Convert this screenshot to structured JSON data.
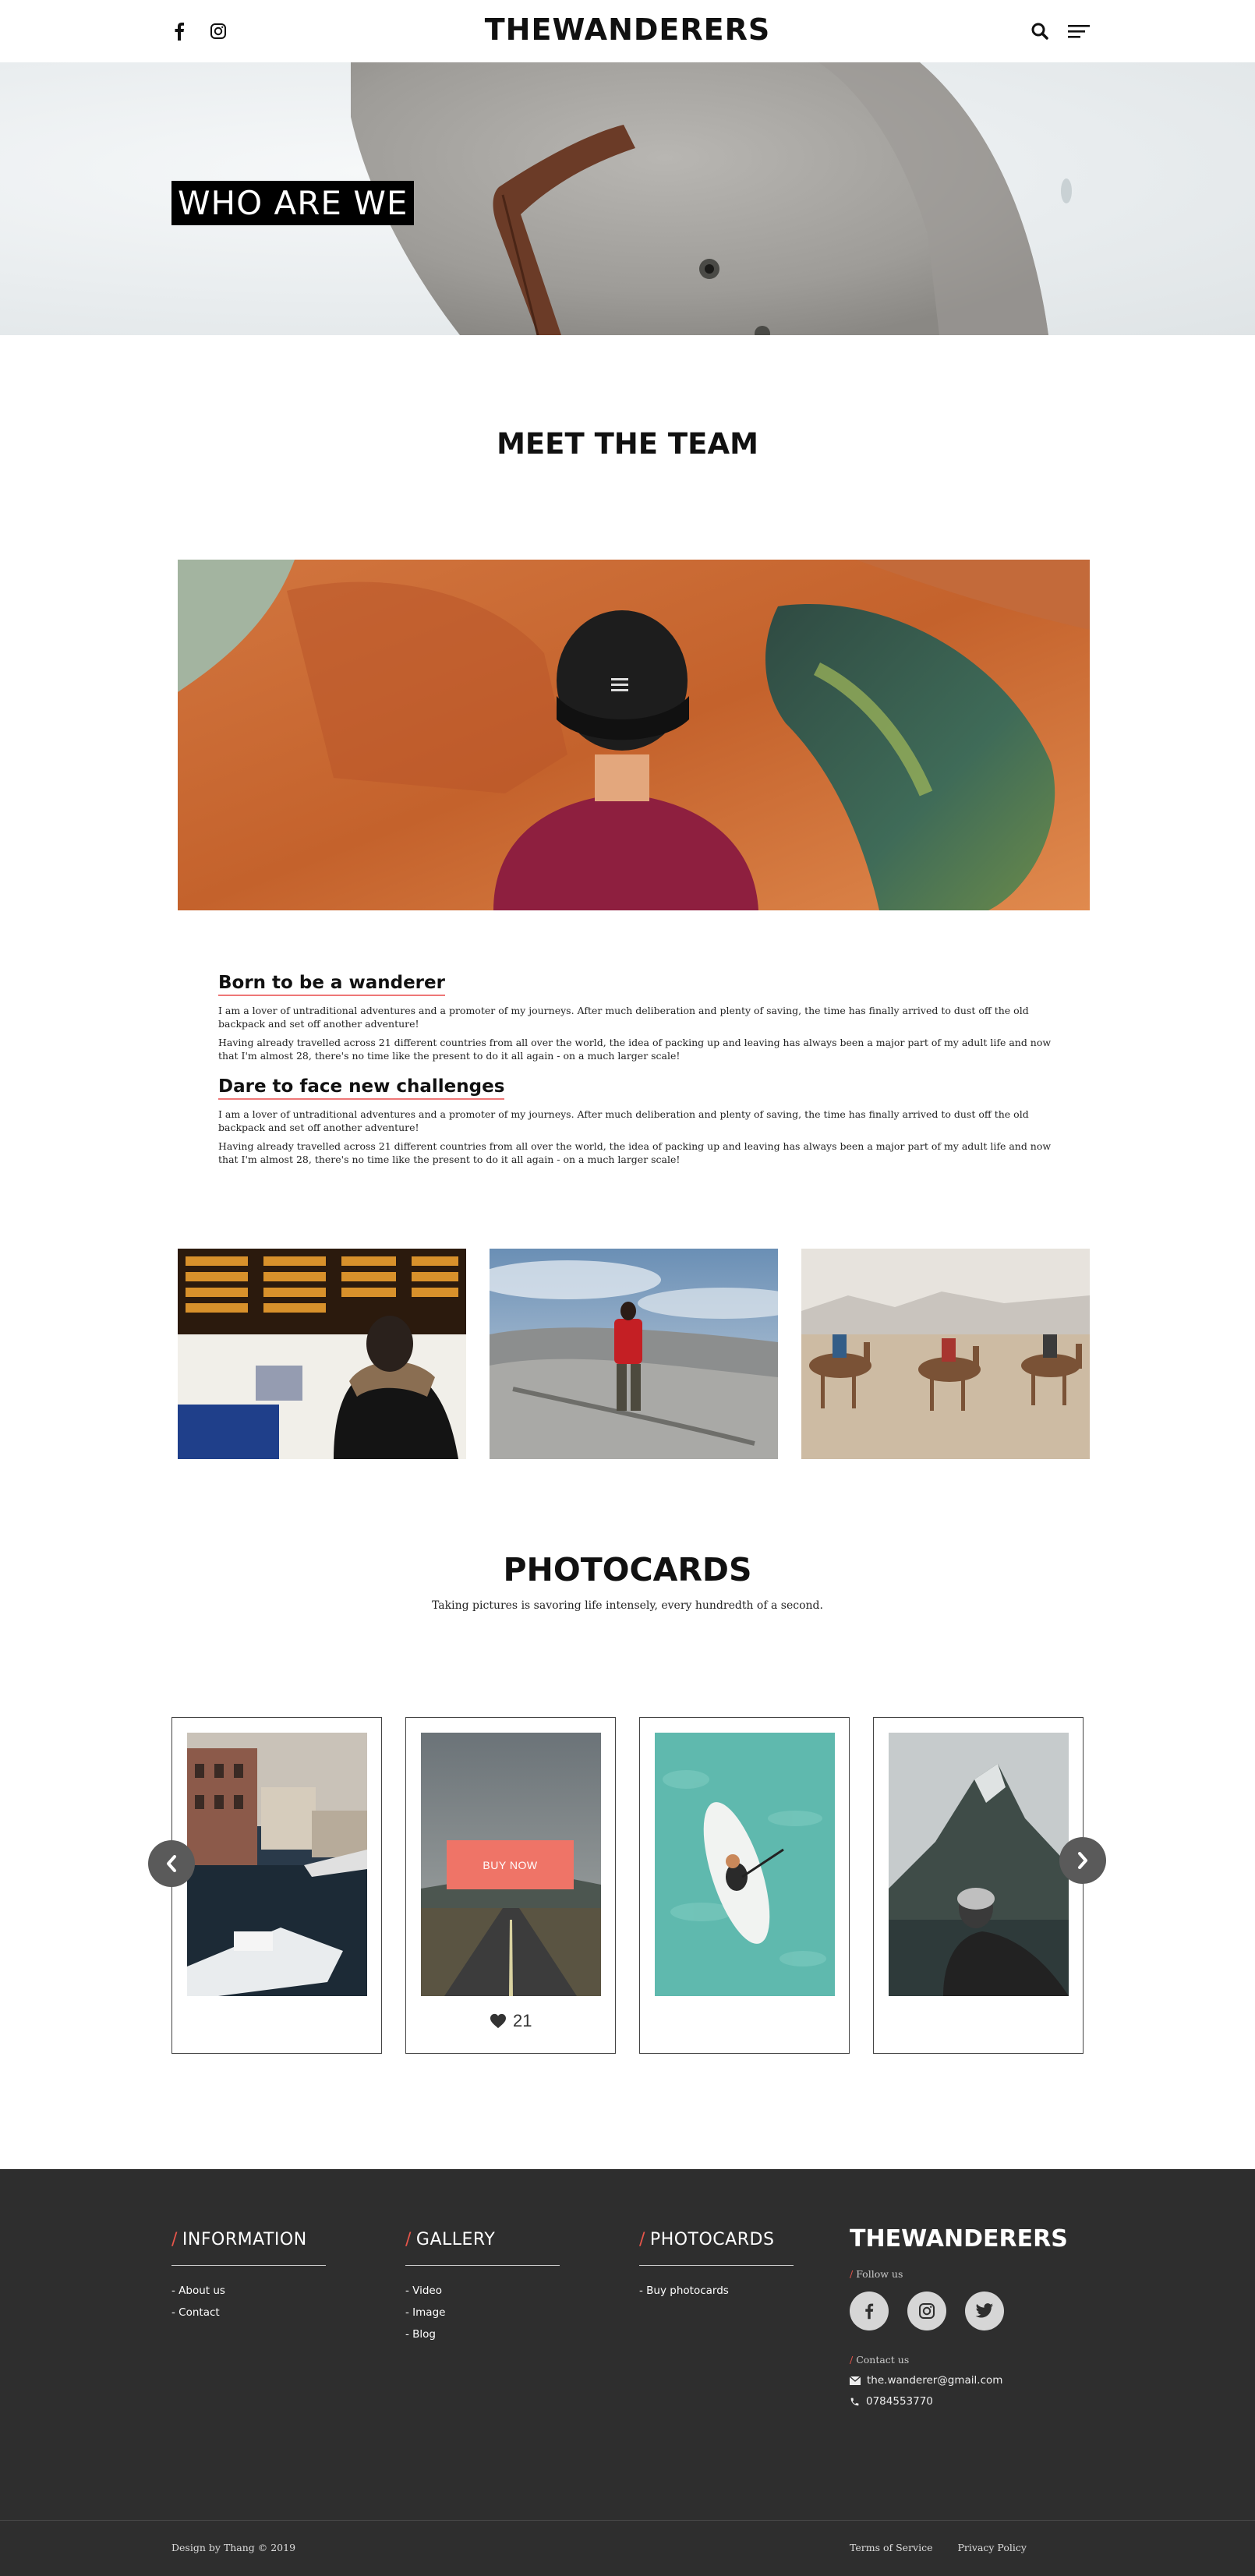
{
  "header": {
    "brand": "THEWANDERERS",
    "icons": [
      "facebook-icon",
      "instagram-icon",
      "search-icon",
      "menu-icon"
    ]
  },
  "hero": {
    "title": "WHO ARE WE"
  },
  "team": {
    "title": "MEET THE TEAM",
    "sections": [
      {
        "heading": "Born to be a wanderer",
        "paragraphs": [
          "I am a lover of untraditional adventures and a promoter of my journeys. After much deliberation and plenty of saving, the time has finally arrived to dust off the old backpack and set off another adventure!",
          "Having already travelled across 21 different countries from all over the world, the idea of packing up and leaving has always been a major part of my adult life and now that I'm almost 28, there's no time like the present to do it all again - on a much larger scale!"
        ]
      },
      {
        "heading": "Dare to face new challenges",
        "paragraphs": [
          "I am a lover of untraditional adventures and a promoter of my journeys. After much deliberation and plenty of saving, the time has finally arrived to dust off the old backpack and set off another adventure!",
          "Having already travelled across 21 different countries from all over the world, the idea of packing up and leaving has always been a major part of my adult life and now that I'm almost 28, there's no time like the present to do it all again - on a much larger scale!"
        ]
      }
    ]
  },
  "photocards": {
    "title": "PHOTOCARDS",
    "subtitle": "Taking pictures is savoring life intensely, every hundredth of a second.",
    "buy_label": "BUY NOW",
    "likes": "21"
  },
  "footer": {
    "columns": [
      {
        "title": "INFORMATION",
        "links": [
          "- About us",
          "- Contact"
        ]
      },
      {
        "title": "GALLERY",
        "links": [
          "- Video",
          "- Image",
          "- Blog"
        ]
      },
      {
        "title": "PHOTOCARDS",
        "links": [
          "- Buy photocards"
        ]
      }
    ],
    "brand": "THEWANDERERS",
    "follow_label": "Follow us",
    "contact_label": "Contact us",
    "email": "the.wanderer@gmail.com",
    "phone": "0784553770",
    "credit": "Design by Thang © 2019",
    "terms": "Terms of Service",
    "privacy": "Privacy Policy"
  },
  "colors": {
    "accent": "#ef7467",
    "footer_bg": "#2e2e2e",
    "text": "#111111"
  }
}
